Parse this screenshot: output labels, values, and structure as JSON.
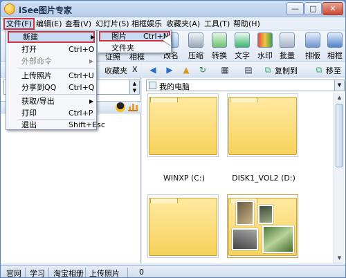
{
  "window": {
    "title": "iSee图片专家",
    "min_label": "—",
    "max_label": "□",
    "close_label": "✕"
  },
  "menubar": [
    "文件(F)",
    "编辑(E)",
    "查看(V)",
    "幻灯片(S)",
    "相框娱乐",
    "收藏夹(A)",
    "工具(T)",
    "帮助(H)"
  ],
  "toolbar": {
    "items": [
      {
        "label": "改名",
        "icon": "rename-icon"
      },
      {
        "label": "压缩",
        "icon": "compress-icon"
      },
      {
        "label": "转换",
        "icon": "convert-icon"
      },
      {
        "label": "文字",
        "icon": "text-icon"
      },
      {
        "label": "水印",
        "icon": "watermark-icon"
      },
      {
        "label": "批量",
        "icon": "batch-icon"
      },
      {
        "label": "排版",
        "icon": "layout-icon"
      },
      {
        "label": "相框",
        "icon": "frame-icon"
      }
    ],
    "partial_labels": [
      "证照",
      "相框"
    ]
  },
  "left_pane": {
    "tab_label": "收藏夹",
    "close_label": "X"
  },
  "nav": {
    "copy_to": "复制到",
    "move_to": "移至"
  },
  "address": {
    "value": "我的电脑"
  },
  "thumbnails": [
    {
      "label": "WINXP (C:)"
    },
    {
      "label": "DISK1_VOL2 (D:)"
    },
    {
      "label": ""
    },
    {
      "label": ""
    }
  ],
  "file_menu": {
    "items": [
      {
        "label": "新建",
        "shortcut": "",
        "submenu": true,
        "disabled": false
      },
      {
        "label": "打开",
        "shortcut": "Ctrl+O",
        "submenu": false,
        "disabled": false
      },
      {
        "label": "外部命令",
        "shortcut": "",
        "submenu": true,
        "disabled": true
      },
      {
        "label": "上传照片",
        "shortcut": "Ctrl+U",
        "submenu": false,
        "disabled": false
      },
      {
        "label": "分享到QQ",
        "shortcut": "Ctrl+Q",
        "submenu": false,
        "disabled": false
      },
      {
        "label": "获取/导出",
        "shortcut": "",
        "submenu": true,
        "disabled": false
      },
      {
        "label": "打印",
        "shortcut": "Ctrl+P",
        "submenu": false,
        "disabled": false
      },
      {
        "label": "退出",
        "shortcut": "Shift+Esc",
        "submenu": false,
        "disabled": false
      }
    ]
  },
  "new_submenu": {
    "items": [
      {
        "label": "图片",
        "shortcut": "Ctrl+N"
      },
      {
        "label": "文件夹",
        "shortcut": ""
      }
    ]
  },
  "statusbar": {
    "items": [
      "官网",
      "学习",
      "淘宝相册",
      "上传照片",
      "0"
    ]
  },
  "colors": {
    "highlight_border": "#d0343f",
    "highlight_fill": "#c9dcf3",
    "folder": "#f7d25c",
    "chrome": "#dfe9f5"
  }
}
